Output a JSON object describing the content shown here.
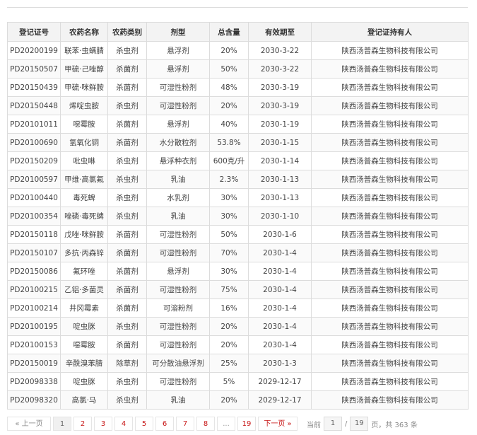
{
  "table": {
    "headers": [
      "登记证号",
      "农药名称",
      "农药类别",
      "剂型",
      "总含量",
      "有效期至",
      "登记证持有人"
    ],
    "rows": [
      [
        "PD20200199",
        "联苯·虫螨腈",
        "杀虫剂",
        "悬浮剂",
        "20%",
        "2030-3-22",
        "陕西汤普森生物科技有限公司"
      ],
      [
        "PD20150507",
        "甲硫·己唑醇",
        "杀菌剂",
        "悬浮剂",
        "50%",
        "2030-3-22",
        "陕西汤普森生物科技有限公司"
      ],
      [
        "PD20150439",
        "甲硫·咪鲜胺",
        "杀菌剂",
        "可湿性粉剂",
        "48%",
        "2030-3-19",
        "陕西汤普森生物科技有限公司"
      ],
      [
        "PD20150448",
        "烯啶虫胺",
        "杀虫剂",
        "可湿性粉剂",
        "20%",
        "2030-3-19",
        "陕西汤普森生物科技有限公司"
      ],
      [
        "PD20101011",
        "噁霉胺",
        "杀菌剂",
        "悬浮剂",
        "40%",
        "2030-1-19",
        "陕西汤普森生物科技有限公司"
      ],
      [
        "PD20100690",
        "氢氧化铜",
        "杀菌剂",
        "水分散粒剂",
        "53.8%",
        "2030-1-15",
        "陕西汤普森生物科技有限公司"
      ],
      [
        "PD20150209",
        "吡虫啉",
        "杀虫剂",
        "悬浮种衣剂",
        "600克/升",
        "2030-1-14",
        "陕西汤普森生物科技有限公司"
      ],
      [
        "PD20100597",
        "甲维·高氯氟",
        "杀虫剂",
        "乳油",
        "2.3%",
        "2030-1-13",
        "陕西汤普森生物科技有限公司"
      ],
      [
        "PD20100440",
        "毒死蜱",
        "杀虫剂",
        "水乳剂",
        "30%",
        "2030-1-13",
        "陕西汤普森生物科技有限公司"
      ],
      [
        "PD20100354",
        "唑磷·毒死蜱",
        "杀虫剂",
        "乳油",
        "30%",
        "2030-1-10",
        "陕西汤普森生物科技有限公司"
      ],
      [
        "PD20150118",
        "戊唑·咪鲜胺",
        "杀菌剂",
        "可湿性粉剂",
        "50%",
        "2030-1-6",
        "陕西汤普森生物科技有限公司"
      ],
      [
        "PD20150107",
        "多抗·丙森锌",
        "杀菌剂",
        "可湿性粉剂",
        "70%",
        "2030-1-4",
        "陕西汤普森生物科技有限公司"
      ],
      [
        "PD20150086",
        "氟环唑",
        "杀菌剂",
        "悬浮剂",
        "30%",
        "2030-1-4",
        "陕西汤普森生物科技有限公司"
      ],
      [
        "PD20100215",
        "乙铝·多菌灵",
        "杀菌剂",
        "可湿性粉剂",
        "75%",
        "2030-1-4",
        "陕西汤普森生物科技有限公司"
      ],
      [
        "PD20100214",
        "井冈霉素",
        "杀菌剂",
        "可溶粉剂",
        "16%",
        "2030-1-4",
        "陕西汤普森生物科技有限公司"
      ],
      [
        "PD20100195",
        "啶虫脒",
        "杀虫剂",
        "可湿性粉剂",
        "20%",
        "2030-1-4",
        "陕西汤普森生物科技有限公司"
      ],
      [
        "PD20100153",
        "噁霉胺",
        "杀菌剂",
        "可湿性粉剂",
        "20%",
        "2030-1-4",
        "陕西汤普森生物科技有限公司"
      ],
      [
        "PD20150019",
        "辛酰溴苯腈",
        "除草剂",
        "可分散油悬浮剂",
        "25%",
        "2030-1-3",
        "陕西汤普森生物科技有限公司"
      ],
      [
        "PD20098338",
        "啶虫脒",
        "杀虫剂",
        "可湿性粉剂",
        "5%",
        "2029-12-17",
        "陕西汤普森生物科技有限公司"
      ],
      [
        "PD20098320",
        "高氯·马",
        "杀虫剂",
        "乳油",
        "20%",
        "2029-12-17",
        "陕西汤普森生物科技有限公司"
      ]
    ]
  },
  "pager": {
    "prev_label": "« 上一页",
    "pages": [
      "1",
      "2",
      "3",
      "4",
      "5",
      "6",
      "7",
      "8",
      "...",
      "19"
    ],
    "next_label": "下一页 »",
    "current_label": "当前",
    "current_page": "1",
    "total_pages": "19",
    "total_text": "页，共 363 条"
  }
}
